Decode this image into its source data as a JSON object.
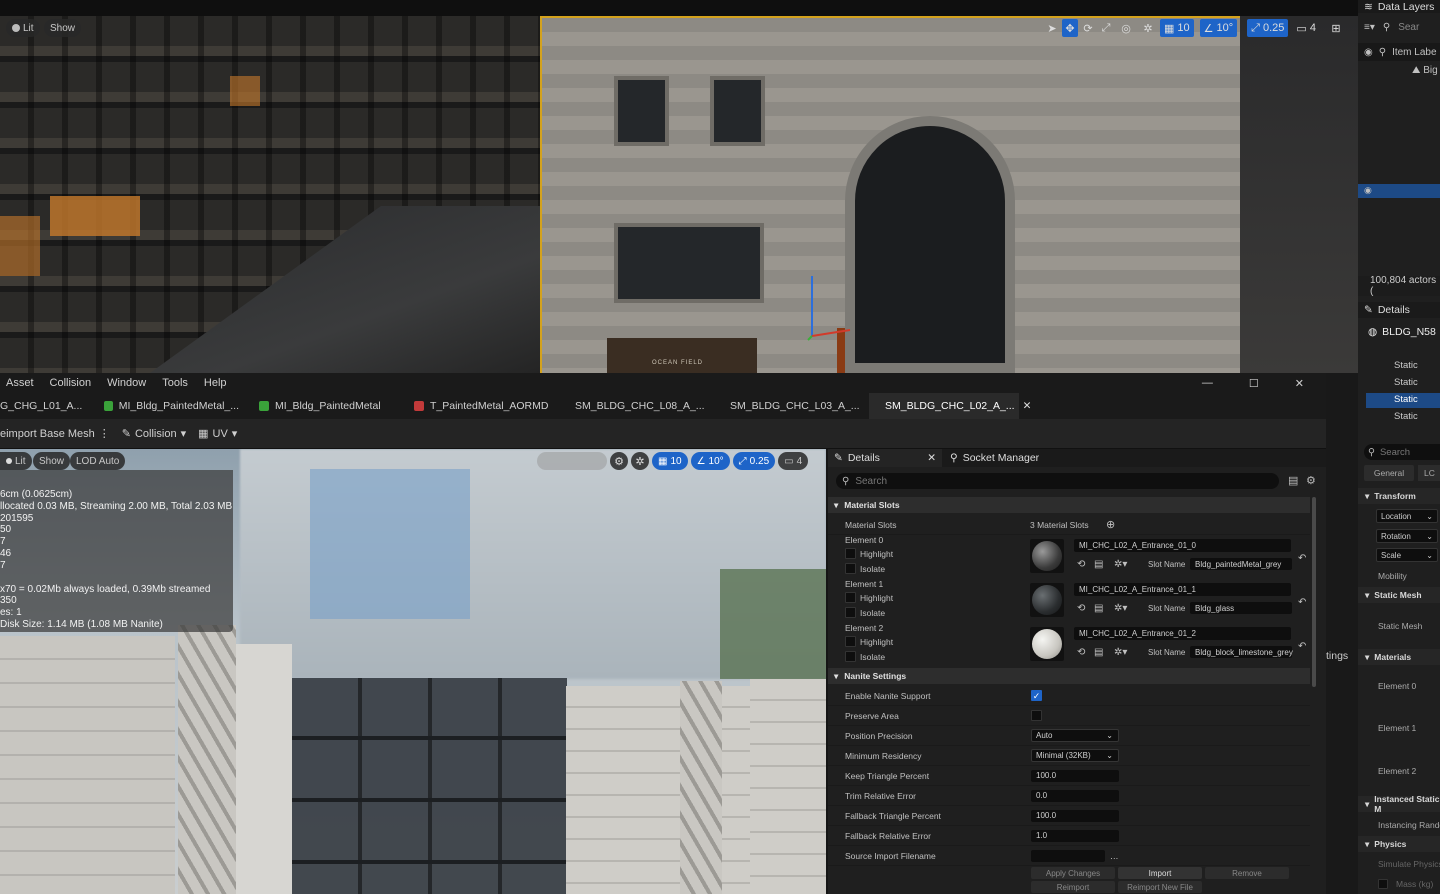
{
  "top_viewport": {
    "chips": {
      "lit": "Lit",
      "show": "Show"
    },
    "tools": {
      "grid": "10",
      "angle": "10°",
      "scale": "0.25",
      "camera": "4"
    },
    "facade_sign": "OCEAN FIELD"
  },
  "menu": [
    "Asset",
    "Collision",
    "Window",
    "Tools",
    "Help"
  ],
  "tabs": [
    {
      "label": "G_CHG_L01_A..."
    },
    {
      "label": "MI_Bldg_PaintedMetal_..."
    },
    {
      "label": "MI_Bldg_PaintedMetal"
    },
    {
      "label": "T_PaintedMetal_AORMD"
    },
    {
      "label": "SM_BLDG_CHC_L08_A_..."
    },
    {
      "label": "SM_BLDG_CHC_L03_A_..."
    },
    {
      "label": "SM_BLDG_CHC_L02_A_..."
    }
  ],
  "toolbar": {
    "reimport": "eimport Base Mesh",
    "collision": "Collision",
    "uv": "UV"
  },
  "viewport": {
    "chips": {
      "lit": "Lit",
      "show": "Show",
      "lod": "LOD Auto"
    },
    "tools": {
      "grid": "10",
      "angle": "10°",
      "scale": "0.25",
      "camera": "4"
    },
    "stats": [
      "6cm (0.0625cm)",
      "llocated 0.03 MB, Streaming 2.00 MB, Total 2.03 MB",
      "201595",
      "50",
      "7",
      "46",
      "7",
      "x70 = 0.02Mb always loaded, 0.39Mb streamed",
      "350",
      "es: 1",
      " Disk Size: 1.14 MB (1.08 MB Nanite)"
    ]
  },
  "details": {
    "tab_details": "Details",
    "tab_socket": "Socket Manager",
    "search_placeholder": "Search",
    "material_slots_header": "Material Slots",
    "material_slots_label": "Material Slots",
    "material_slots_count": "3 Material Slots",
    "elements": [
      {
        "label": "Element 0",
        "material": "MI_CHC_L02_A_Entrance_01_0",
        "slot_name": "Bldg_paintedMetal_grey",
        "highlight": "Highlight",
        "isolate": "Isolate",
        "slot_label": "Slot Name"
      },
      {
        "label": "Element 1",
        "material": "MI_CHC_L02_A_Entrance_01_1",
        "slot_name": "Bldg_glass",
        "highlight": "Highlight",
        "isolate": "Isolate",
        "slot_label": "Slot Name"
      },
      {
        "label": "Element 2",
        "material": "MI_CHC_L02_A_Entrance_01_2",
        "slot_name": "Bldg_block_limestone_grey",
        "highlight": "Highlight",
        "isolate": "Isolate",
        "slot_label": "Slot Name"
      }
    ],
    "nanite_header": "Nanite Settings",
    "nanite": {
      "enable_label": "Enable Nanite Support",
      "preserve_label": "Preserve Area",
      "position_label": "Position Precision",
      "position_value": "Auto",
      "residency_label": "Minimum Residency",
      "residency_value": "Minimal (32KB)",
      "keep_label": "Keep Triangle Percent",
      "keep_value": "100.0",
      "trim_label": "Trim Relative Error",
      "trim_value": "0.0",
      "fallback_pct_label": "Fallback Triangle Percent",
      "fallback_pct_value": "100.0",
      "fallback_err_label": "Fallback Relative Error",
      "fallback_err_value": "1.0",
      "source_label": "Source Import Filename"
    },
    "buttons": {
      "apply": "Apply Changes",
      "import": "Import",
      "remove": "Remove",
      "reimport": "Reimport",
      "reimport_new": "Reimport New File"
    }
  },
  "gap_text": "tings",
  "sidebar": {
    "data_layers": "Data Layers",
    "search": "Sear",
    "item_label": "Item Labe",
    "tree_item": "Big",
    "actors": "100,804 actors (",
    "details": "Details",
    "bldg": "BLDG_N58",
    "static_items": [
      "Static",
      "Static",
      "Static",
      "Static",
      "Static"
    ],
    "search2": "Search",
    "general": "General",
    "lc": "LC",
    "transform": "Transform",
    "location": "Location",
    "rotation": "Rotation",
    "scale": "Scale",
    "mobility": "Mobility",
    "static_mesh_header": "Static Mesh",
    "static_mesh": "Static Mesh",
    "materials": "Materials",
    "element0": "Element 0",
    "element1": "Element 1",
    "element2": "Element 2",
    "instanced": "Instanced Static M",
    "instancing": "Instancing Rando",
    "physics": "Physics",
    "simulate": "Simulate Physics",
    "mass": "Mass (kg)"
  },
  "colors": {
    "accent": "#1e64c8",
    "selection": "#d4a21c"
  }
}
